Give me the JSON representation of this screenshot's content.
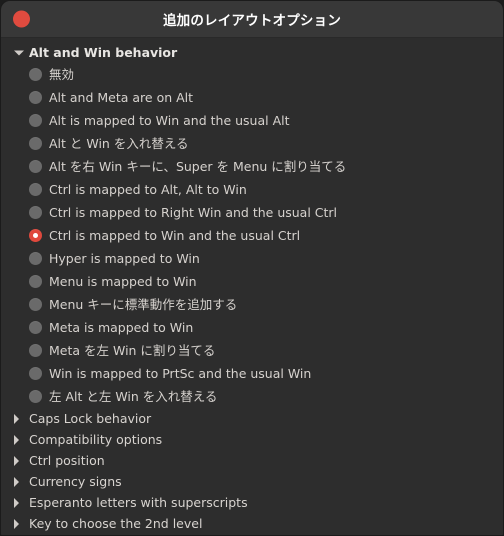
{
  "window": {
    "title": "追加のレイアウトオプション",
    "close_label": "",
    "accent_color": "#e0483c",
    "titlebar_color": "#383838",
    "background_color": "#2d2d2d",
    "text_color": "#d6d2ce"
  },
  "tree": {
    "groups": [
      {
        "label": "Alt and Win behavior",
        "expanded": true,
        "expander_icon": "triangle-down-icon",
        "options": [
          {
            "label": "無効",
            "selected": false
          },
          {
            "label": "Alt and Meta are on Alt",
            "selected": false
          },
          {
            "label": "Alt is mapped to Win and the usual Alt",
            "selected": false
          },
          {
            "label": "Alt と Win を入れ替える",
            "selected": false
          },
          {
            "label": "Alt を右 Win キーに、Super を Menu に割り当てる",
            "selected": false
          },
          {
            "label": "Ctrl is mapped to Alt, Alt to Win",
            "selected": false
          },
          {
            "label": "Ctrl is mapped to Right Win and the usual Ctrl",
            "selected": false
          },
          {
            "label": "Ctrl is mapped to Win and the usual Ctrl",
            "selected": true
          },
          {
            "label": "Hyper is mapped to Win",
            "selected": false
          },
          {
            "label": "Menu is mapped to Win",
            "selected": false
          },
          {
            "label": "Menu キーに標準動作を追加する",
            "selected": false
          },
          {
            "label": "Meta is mapped to Win",
            "selected": false
          },
          {
            "label": "Meta を左 Win に割り当てる",
            "selected": false
          },
          {
            "label": "Win is mapped to PrtSc and the usual Win",
            "selected": false
          },
          {
            "label": "左 Alt と左 Win を入れ替える",
            "selected": false
          }
        ]
      },
      {
        "label": "Caps Lock behavior",
        "expanded": false,
        "expander_icon": "triangle-right-icon",
        "options": []
      },
      {
        "label": "Compatibility options",
        "expanded": false,
        "expander_icon": "triangle-right-icon",
        "options": []
      },
      {
        "label": "Ctrl position",
        "expanded": false,
        "expander_icon": "triangle-right-icon",
        "options": []
      },
      {
        "label": "Currency signs",
        "expanded": false,
        "expander_icon": "triangle-right-icon",
        "options": []
      },
      {
        "label": "Esperanto letters with superscripts",
        "expanded": false,
        "expander_icon": "triangle-right-icon",
        "options": []
      },
      {
        "label": "Key to choose the 2nd level",
        "expanded": false,
        "expander_icon": "triangle-right-icon",
        "options": []
      }
    ]
  }
}
